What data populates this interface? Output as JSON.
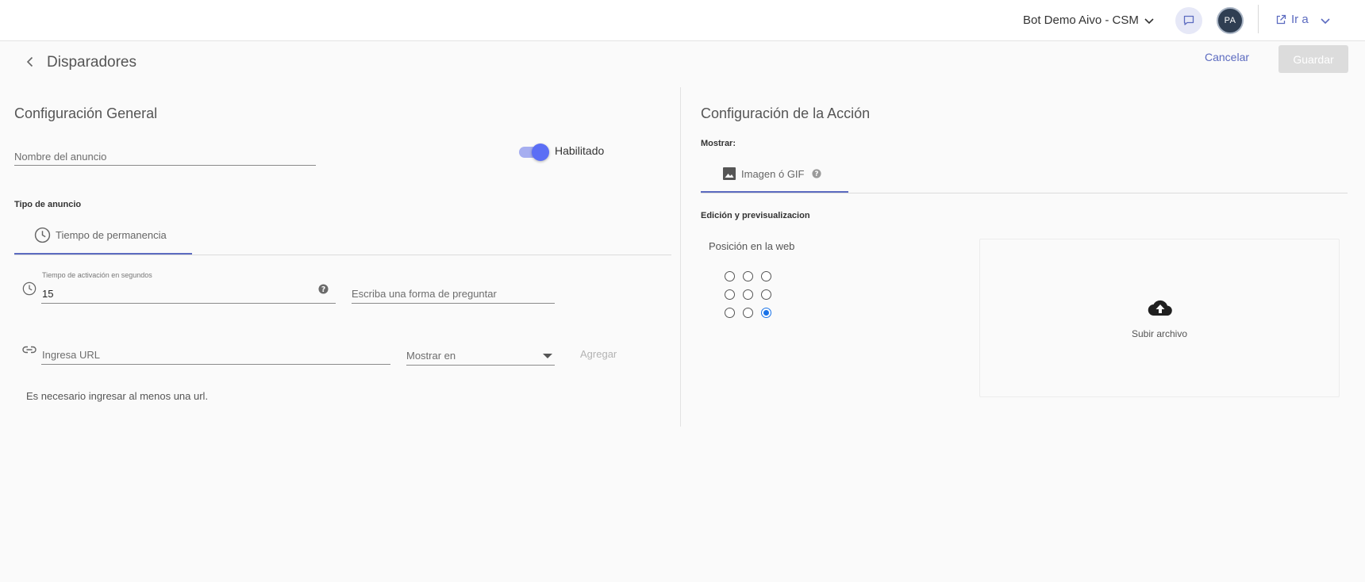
{
  "topbar": {
    "bot_name": "Bot Demo Aivo - CSM",
    "avatar_initials": "PA",
    "go_to_label": "Ir a"
  },
  "header": {
    "title": "Disparadores",
    "cancel_label": "Cancelar",
    "save_label": "Guardar"
  },
  "general": {
    "title": "Configuración General",
    "name_placeholder": "Nombre del anuncio",
    "enabled_label": "Habilitado",
    "enabled": true,
    "ad_type_label": "Tipo de anuncio",
    "tab_label": "Tiempo de permanencia",
    "activation_label": "Tiempo de activación en segundos",
    "activation_value": "15",
    "question_placeholder": "Escriba una forma de preguntar",
    "url_placeholder": "Ingresa URL",
    "show_in_placeholder": "Mostrar en",
    "add_label": "Agregar",
    "note": "Es necesario ingresar al menos una url."
  },
  "action": {
    "title": "Configuración de la Acción",
    "show_label": "Mostrar:",
    "tab_label": "Imagen ó GIF",
    "edit_label": "Edición y previsualizacion",
    "position_label": "Posición en la web",
    "selected_position": "bottom-right",
    "upload_label": "Subir archivo"
  },
  "colors": {
    "accent": "#5c6bc0",
    "toggle_on": "#5b6ef5",
    "radio_selected": "#1a73e8"
  }
}
